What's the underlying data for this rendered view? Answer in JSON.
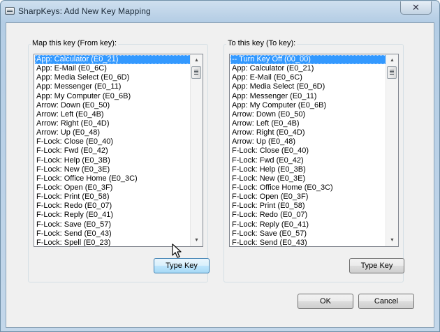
{
  "window": {
    "title": "SharpKeys: Add New Key Mapping",
    "close_glyph": "✕",
    "icon": "keyboard-icon"
  },
  "from_group": {
    "title": "Map this key (From key):",
    "items": [
      "App: Calculator (E0_21)",
      "App: E-Mail (E0_6C)",
      "App: Media Select (E0_6D)",
      "App: Messenger (E0_11)",
      "App: My Computer (E0_6B)",
      "Arrow: Down (E0_50)",
      "Arrow: Left (E0_4B)",
      "Arrow: Right (E0_4D)",
      "Arrow: Up (E0_48)",
      "F-Lock: Close (E0_40)",
      "F-Lock: Fwd (E0_42)",
      "F-Lock: Help (E0_3B)",
      "F-Lock: New (E0_3E)",
      "F-Lock: Office Home (E0_3C)",
      "F-Lock: Open (E0_3F)",
      "F-Lock: Print (E0_58)",
      "F-Lock: Redo (E0_07)",
      "F-Lock: Reply (E0_41)",
      "F-Lock: Save (E0_57)",
      "F-Lock: Send (E0_43)",
      "F-Lock: Spell (E0_23)"
    ],
    "selected": "App: Calculator (E0_21)",
    "type_key_label": "Type Key"
  },
  "to_group": {
    "title": "To this key (To key):",
    "items": [
      "-- Turn Key Off (00_00)",
      "App: Calculator (E0_21)",
      "App: E-Mail (E0_6C)",
      "App: Media Select (E0_6D)",
      "App: Messenger (E0_11)",
      "App: My Computer (E0_6B)",
      "Arrow: Down (E0_50)",
      "Arrow: Left (E0_4B)",
      "Arrow: Right (E0_4D)",
      "Arrow: Up (E0_48)",
      "F-Lock: Close (E0_40)",
      "F-Lock: Fwd (E0_42)",
      "F-Lock: Help (E0_3B)",
      "F-Lock: New (E0_3E)",
      "F-Lock: Office Home (E0_3C)",
      "F-Lock: Open (E0_3F)",
      "F-Lock: Print (E0_58)",
      "F-Lock: Redo (E0_07)",
      "F-Lock: Reply (E0_41)",
      "F-Lock: Save (E0_57)",
      "F-Lock: Send (E0_43)"
    ],
    "selected": "-- Turn Key Off (00_00)",
    "type_key_label": "Type Key"
  },
  "footer": {
    "ok_label": "OK",
    "cancel_label": "Cancel"
  },
  "colors": {
    "selection": "#3399ff",
    "window_frame": "#bdd3e8"
  }
}
